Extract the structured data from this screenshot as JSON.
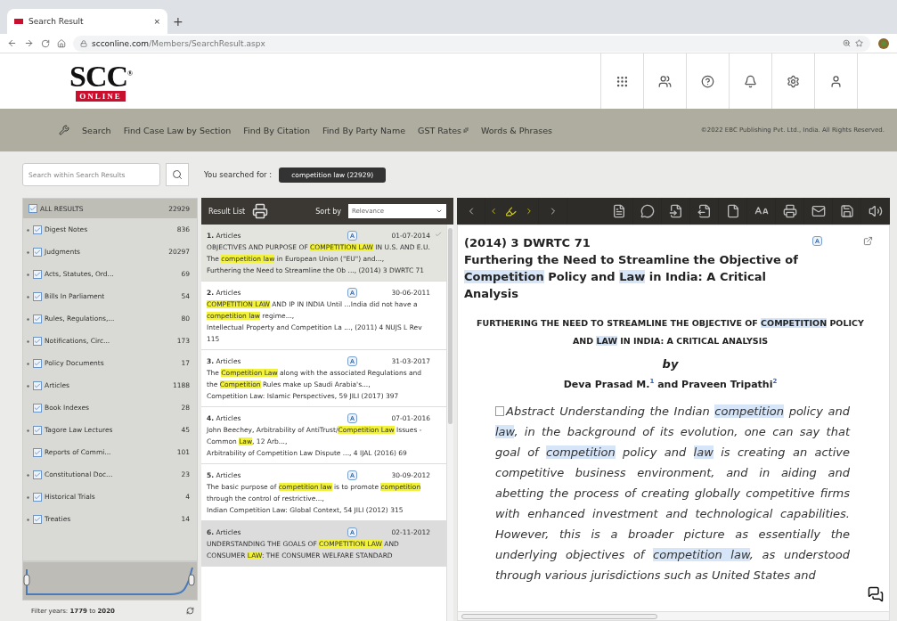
{
  "browser": {
    "tab": {
      "title": "Search Result",
      "close": "×"
    },
    "new_tab": "+",
    "url": {
      "domain": "scconline.com",
      "path": "/Members/SearchResult.aspx"
    }
  },
  "logo": {
    "top": "SCC",
    "mark": "®",
    "bottom": "ONLINE"
  },
  "nav": {
    "items": [
      {
        "label": "Search",
        "badge": false
      },
      {
        "label": "Find Case Law by Section",
        "badge": false
      },
      {
        "label": "Find By Citation",
        "badge": false
      },
      {
        "label": "Find By Party Name",
        "badge": false
      },
      {
        "label": "GST Rates",
        "badge": true
      },
      {
        "label": "Words & Phrases",
        "badge": false
      }
    ],
    "copyright": "©2022 EBC Publishing Pvt. Ltd., India. All Rights Reserved."
  },
  "search": {
    "placeholder": "Search within Search Results"
  },
  "query": {
    "label": "You searched for :",
    "chip": "competition law (22929)"
  },
  "facets": {
    "all": {
      "label": "ALL RESULTS",
      "count": "22929",
      "checked": true
    },
    "items": [
      {
        "label": "Digest Notes",
        "count": "836",
        "checked": true,
        "expandable": true
      },
      {
        "label": "Judgments",
        "count": "20297",
        "checked": true,
        "expandable": true
      },
      {
        "label": "Acts, Statutes, Ord...",
        "count": "69",
        "checked": true,
        "expandable": true
      },
      {
        "label": "Bills In Parliament",
        "count": "54",
        "checked": true,
        "expandable": true
      },
      {
        "label": "Rules, Regulations,...",
        "count": "80",
        "checked": true,
        "expandable": true
      },
      {
        "label": "Notifications, Circ...",
        "count": "173",
        "checked": true,
        "expandable": true
      },
      {
        "label": "Policy Documents",
        "count": "17",
        "checked": true,
        "expandable": true
      },
      {
        "label": "Articles",
        "count": "1188",
        "checked": true,
        "expandable": true
      },
      {
        "label": "Book Indexes",
        "count": "28",
        "checked": true,
        "expandable": false
      },
      {
        "label": "Tagore Law Lectures",
        "count": "45",
        "checked": true,
        "expandable": true
      },
      {
        "label": "Reports of Commi...",
        "count": "101",
        "checked": true,
        "expandable": false
      },
      {
        "label": "Constitutional Doc...",
        "count": "23",
        "checked": true,
        "expandable": true
      },
      {
        "label": "Historical Trials",
        "count": "4",
        "checked": true,
        "expandable": true
      },
      {
        "label": "Treaties",
        "count": "14",
        "checked": true,
        "expandable": true
      }
    ]
  },
  "years": {
    "text": "Filter years: **1779** to **2020**"
  },
  "results": {
    "title": "Result List",
    "sort_label": "Sort by",
    "sort_value": "Relevance",
    "items": [
      {
        "number": "1.",
        "category": "Articles",
        "date": "01-07-2014",
        "selected": true,
        "hovered": false,
        "snippet": [
          {
            "text": "OBJECTIVES AND PURPOSE OF ",
            "highlight": false
          },
          {
            "text": "COMPETITION LAW",
            "highlight": true
          },
          {
            "text": " IN U.S. AND E.U. The ",
            "highlight": false
          },
          {
            "text": "competition law",
            "highlight": true
          },
          {
            "text": " in European Union (\"EU\") and...,",
            "highlight": false
          }
        ],
        "source": "Furthering the Need to Streamline the Ob ..., (2014) 3 DWRTC 71"
      },
      {
        "number": "2.",
        "category": "Articles",
        "date": "30-06-2011",
        "selected": false,
        "hovered": false,
        "snippet": [
          {
            "text": "COMPETITION LAW",
            "highlight": true
          },
          {
            "text": " AND IP IN INDIA Until ...India did not have a ",
            "highlight": false
          },
          {
            "text": "competition law",
            "highlight": true
          },
          {
            "text": " regime...,",
            "highlight": false
          }
        ],
        "source": "Intellectual Property and Competition La ..., (2011) 4 NUJS L Rev 115"
      },
      {
        "number": "3.",
        "category": "Articles",
        "date": "31-03-2017",
        "selected": false,
        "hovered": false,
        "snippet": [
          {
            "text": "The ",
            "highlight": false
          },
          {
            "text": "Competition Law",
            "highlight": true
          },
          {
            "text": " along with the associated Regulations and the ",
            "highlight": false
          },
          {
            "text": "Competition",
            "highlight": true
          },
          {
            "text": " Rules make up Saudi Arabia's...,",
            "highlight": false
          }
        ],
        "source": "Competition Law: Islamic Perspectives, 59 JILI (2017) 397"
      },
      {
        "number": "4.",
        "category": "Articles",
        "date": "07-01-2016",
        "selected": false,
        "hovered": false,
        "snippet": [
          {
            "text": "John Beechey, Arbitrability of AntiTrust/",
            "highlight": false
          },
          {
            "text": "Competition Law",
            "highlight": true
          },
          {
            "text": " Issues - Common ",
            "highlight": false
          },
          {
            "text": "Law",
            "highlight": true
          },
          {
            "text": ", 12 Arb...,",
            "highlight": false
          }
        ],
        "source": "Arbitrability of Competition Law Dispute ..., 4 IJAL (2016) 69"
      },
      {
        "number": "5.",
        "category": "Articles",
        "date": "30-09-2012",
        "selected": false,
        "hovered": false,
        "snippet": [
          {
            "text": "The basic purpose of ",
            "highlight": false
          },
          {
            "text": "competition law",
            "highlight": true
          },
          {
            "text": " is to promote ",
            "highlight": false
          },
          {
            "text": "competition",
            "highlight": true
          },
          {
            "text": " through the control of restrictive...,",
            "highlight": false
          }
        ],
        "source": "Indian Competition Law: Global Context, 54 JILI (2012) 315"
      },
      {
        "number": "6.",
        "category": "Articles",
        "date": "02-11-2012",
        "selected": false,
        "hovered": true,
        "snippet": [
          {
            "text": "UNDERSTANDING THE GOALS OF ",
            "highlight": false
          },
          {
            "text": "COMPETITION LAW",
            "highlight": true
          },
          {
            "text": " AND CONSUMER ",
            "highlight": false
          },
          {
            "text": "LAW",
            "highlight": true
          },
          {
            "text": ": THE CONSUMER WELFARE STANDARD",
            "highlight": false
          }
        ]
      }
    ]
  },
  "document": {
    "citation": "(2014) 3 DWRTC 71",
    "title": [
      {
        "text": "Furthering the Need to Streamline the Objective of ",
        "highlight": false
      },
      {
        "text": "Competition",
        "highlight": true
      },
      {
        "text": " Policy and ",
        "highlight": false
      },
      {
        "text": "Law",
        "highlight": true
      },
      {
        "text": " in India: A Critical Analysis",
        "highlight": false
      }
    ],
    "heading": [
      {
        "text": "FURTHERING THE NEED TO STREAMLINE THE OBJECTIVE OF ",
        "highlight": false
      },
      {
        "text": "COMPETITION",
        "highlight": true
      },
      {
        "text": " POLICY AND ",
        "highlight": false
      },
      {
        "text": "LAW",
        "highlight": true
      },
      {
        "text": " IN INDIA: A CRITICAL ANALYSIS",
        "highlight": false
      }
    ],
    "by": "by",
    "authors": "Deva Prasad M.$^{1}$ and Praveen Tripathi$^{2}$",
    "abstract": [
      {
        "text": "Abstract Understanding the Indian ",
        "highlight": false
      },
      {
        "text": "competition",
        "highlight": true
      },
      {
        "text": " policy and ",
        "highlight": false
      },
      {
        "text": "law",
        "highlight": true
      },
      {
        "text": ", in the background of its evolution, one can say that goal of ",
        "highlight": false
      },
      {
        "text": "competition",
        "highlight": true
      },
      {
        "text": " policy and ",
        "highlight": false
      },
      {
        "text": "law",
        "highlight": true
      },
      {
        "text": " is creating an active competitive business environment, and in aiding and abetting the process of creating globally competitive firms with enhanced investment and technological capabilities. However, this is a broader picture as essentially the underlying objectives of ",
        "highlight": false
      },
      {
        "text": "competition law",
        "highlight": true
      },
      {
        "text": ", as understood through various jurisdictions such as United States and",
        "highlight": false
      }
    ]
  }
}
